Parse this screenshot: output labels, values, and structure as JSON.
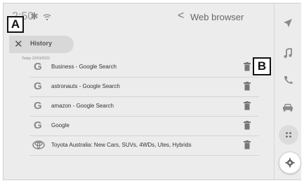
{
  "status_bar": {
    "time": "2:50",
    "bluetooth_icon": "bluetooth-icon",
    "wifi_icon": "wifi-icon",
    "back_glyph": "<",
    "title": "Web browser"
  },
  "callouts": {
    "a": "A",
    "b": "B"
  },
  "history_bar": {
    "close_glyph": "✕",
    "label": "History"
  },
  "history": {
    "date_label": "Today 22/03/2022",
    "items": [
      {
        "icon": "google-icon",
        "icon_glyph": "G",
        "label": "Business - Google Search"
      },
      {
        "icon": "google-icon",
        "icon_glyph": "G",
        "label": "astronauts - Google Search"
      },
      {
        "icon": "google-icon",
        "icon_glyph": "G",
        "label": "amazon - Google Search"
      },
      {
        "icon": "google-icon",
        "icon_glyph": "G",
        "label": "Google"
      },
      {
        "icon": "toyota-logo-icon",
        "icon_glyph": "",
        "label": "Toyota Australia: New Cars, SUVs, 4WDs, Utes, Hybrids"
      }
    ]
  },
  "side_nav": {
    "items": [
      "navigation-arrow-icon",
      "music-note-icon",
      "phone-icon",
      "car-icon",
      "apps-icon",
      "settings-gear-icon"
    ]
  },
  "colors": {
    "background": "#ececec",
    "icon": "#8a8a8a",
    "text": "#333333"
  }
}
